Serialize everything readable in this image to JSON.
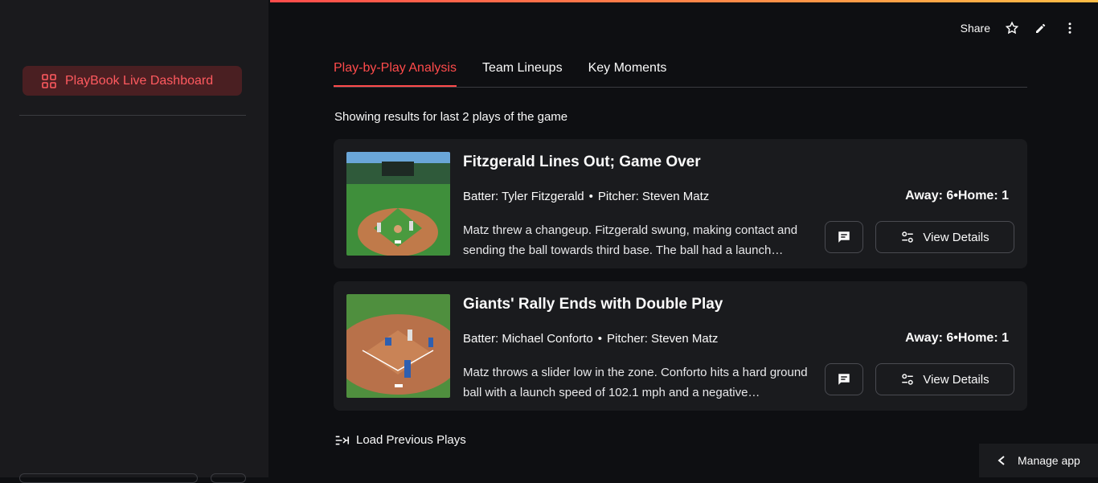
{
  "sidebar": {
    "nav_label": "PlayBook Live Dashboard"
  },
  "toolbar": {
    "share_label": "Share"
  },
  "tabs": [
    {
      "label": "Play-by-Play Analysis"
    },
    {
      "label": "Team Lineups"
    },
    {
      "label": "Key Moments"
    }
  ],
  "results_note": "Showing results for last 2 plays of the game",
  "plays": [
    {
      "title": "Fitzgerald Lines Out; Game Over",
      "batter": "Batter: Tyler Fitzgerald",
      "pitcher": "Pitcher: Steven Matz",
      "away": "Away: 6",
      "home": "Home: 1",
      "description": "Matz threw a changeup. Fitzgerald swung, making contact and sending the ball towards third base. The ball had a launch…",
      "details_label": "View Details"
    },
    {
      "title": "Giants' Rally Ends with Double Play",
      "batter": "Batter: Michael Conforto",
      "pitcher": "Pitcher: Steven Matz",
      "away": "Away: 6",
      "home": "Home: 1",
      "description": "Matz throws a slider low in the zone. Conforto hits a hard ground ball with a launch speed of 102.1 mph and a negative…",
      "details_label": "View Details"
    }
  ],
  "dot": "•",
  "load_previous_label": "Load Previous Plays",
  "manage_app_label": "Manage app",
  "colors": {
    "accent": "#ff4b4b",
    "nav_bg": "#4a1f22",
    "card_bg": "#1a1b1e",
    "sidebar_bg": "#1a1a1d"
  }
}
